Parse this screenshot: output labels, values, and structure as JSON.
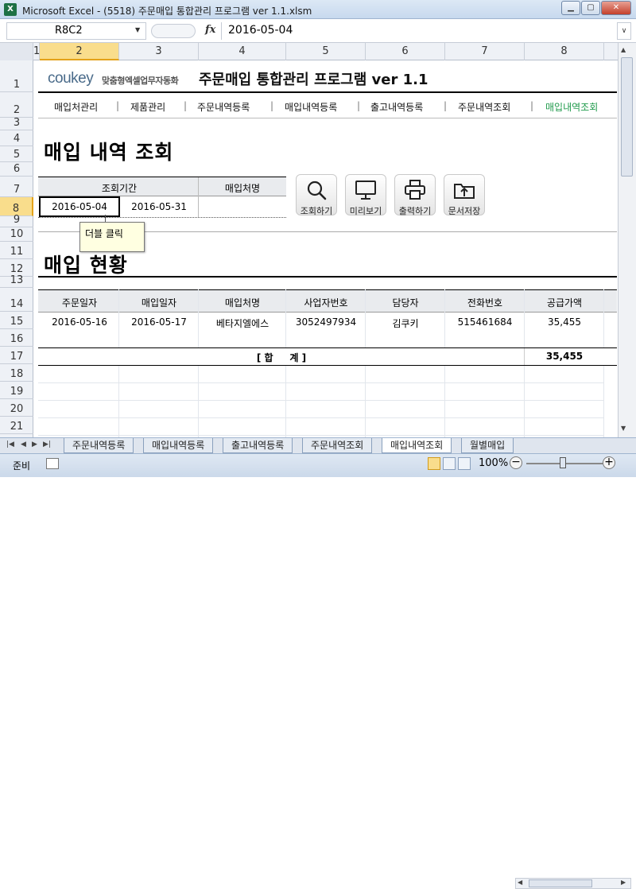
{
  "window": {
    "title": "Microsoft Excel - (5518) 주문매입 통합관리 프로그램 ver 1.1.xlsm",
    "app_icon": "X"
  },
  "formula_bar": {
    "name_box": "R8C2",
    "fx": "fx",
    "value": "2016-05-04"
  },
  "columns": [
    "1",
    "2",
    "3",
    "4",
    "5",
    "6",
    "7",
    "8"
  ],
  "rows": [
    "1",
    "2",
    "3",
    "4",
    "5",
    "6",
    "7",
    "8",
    "9",
    "10",
    "11",
    "12",
    "13",
    "14",
    "15",
    "16",
    "17",
    "18",
    "19",
    "20",
    "21"
  ],
  "header": {
    "logo_main": "coukey",
    "logo_sub": "맞춤형엑셀업무자동화",
    "app_title": "주문매입 통합관리 프로그램 ver 1.1"
  },
  "nav": [
    "매입처관리",
    "제품관리",
    "주문내역등록",
    "매입내역등록",
    "출고내역등록",
    "주문내역조회",
    "매입내역조회"
  ],
  "nav_active": "매입내역조회",
  "query": {
    "title": "매입 내역 조회",
    "period_label": "조회기간",
    "vendor_label": "매입처명",
    "start_date": "2016-05-04",
    "end_date": "2016-05-31",
    "vendor_value": ""
  },
  "buttons": {
    "search": "조회하기",
    "preview": "미리보기",
    "print": "출력하기",
    "save": "문서저장"
  },
  "tooltip": "더블 클릭",
  "status_section": {
    "title": "매입 현황",
    "headers": [
      "주문일자",
      "매입일자",
      "매입처명",
      "사업자번호",
      "담당자",
      "전화번호",
      "공급가액"
    ],
    "rows": [
      [
        "2016-05-16",
        "2016-05-17",
        "베타지엘에스",
        "3052497934",
        "김쿠키",
        "515461684",
        "35,455"
      ]
    ],
    "total_label": "[ 합     계 ]",
    "total_value": "35,455"
  },
  "sheet_tabs": [
    "주문내역등록",
    "매입내역등록",
    "출고내역등록",
    "주문내역조회",
    "매입내역조회",
    "월별매입"
  ],
  "active_tab": "매입내역조회",
  "status_bar": {
    "ready": "준비",
    "zoom": "100%"
  },
  "colors": {
    "accent_green": "#1f9a4b",
    "selection_header": "#f9dd8c",
    "table_header_bg": "#e9ebee"
  }
}
